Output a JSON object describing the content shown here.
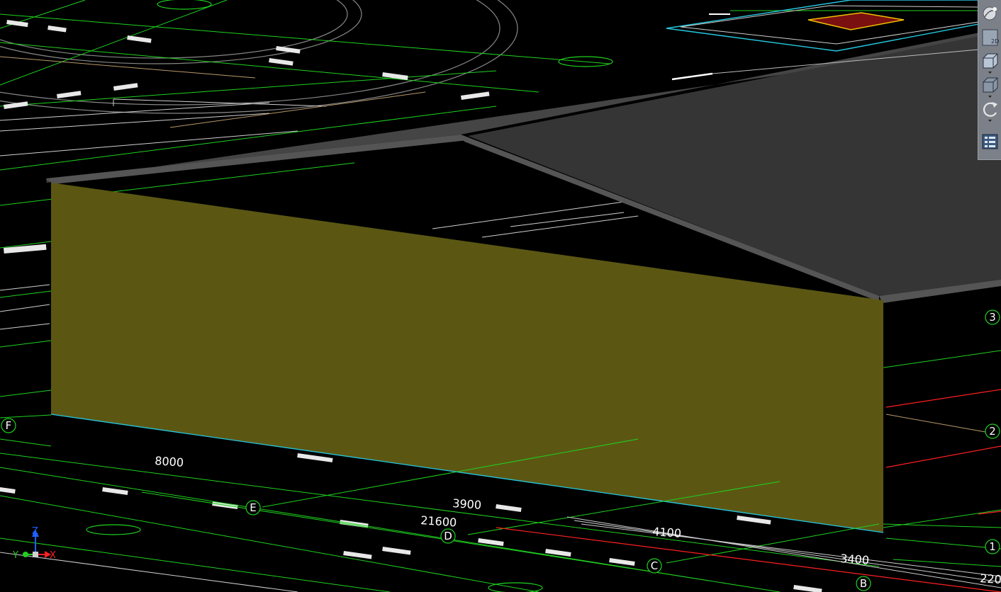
{
  "viewport": {
    "background": "#000000",
    "wall_color": "#5b5713",
    "roof_color": "#353535",
    "roof_edge_color": "#555555",
    "grid_color": "#00ff00",
    "dimension_labels": [
      "8000",
      "3900",
      "21600",
      "4100",
      "3400",
      "220"
    ],
    "grid_bubbles": [
      "F",
      "E",
      "D",
      "C",
      "B",
      "3",
      "2",
      "1"
    ]
  },
  "ucs": {
    "z": "Z",
    "y": "Y",
    "x": "X"
  },
  "navbar": {
    "buttons": [
      {
        "name": "steering-wheel",
        "icon": "steering-wheel-icon"
      },
      {
        "name": "2d-wireframe",
        "icon": "2d-view-icon",
        "label": "2D"
      },
      {
        "name": "view-cube-front",
        "icon": "view-cube-icon"
      },
      {
        "name": "zoom-extents",
        "icon": "cube-icon"
      },
      {
        "name": "orbit",
        "icon": "orbit-icon"
      },
      {
        "name": "show-motion",
        "icon": "show-motion-icon"
      }
    ]
  }
}
